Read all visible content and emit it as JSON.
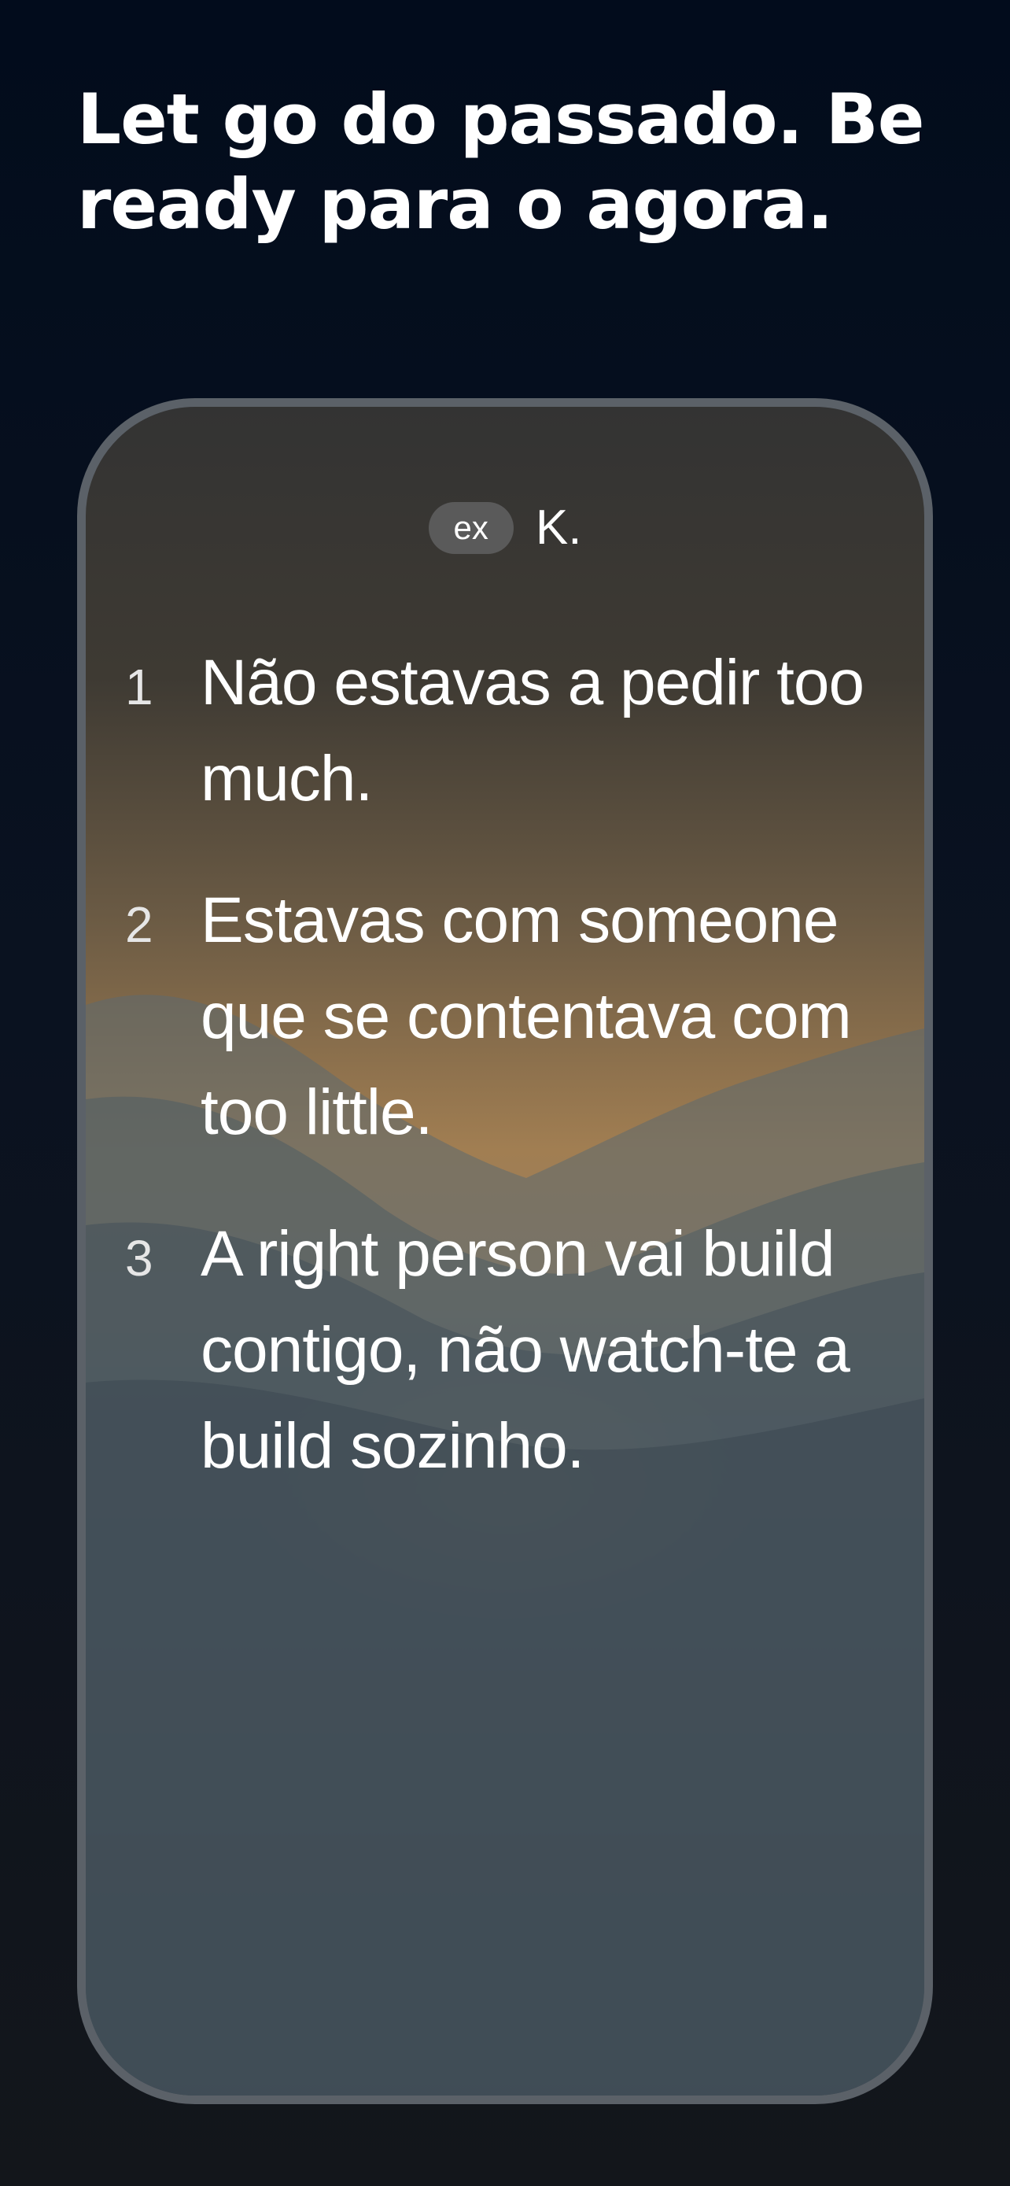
{
  "headline": "Let go do passado. Be ready para o agora.",
  "card": {
    "badge": "ex",
    "name": "K.",
    "items": [
      {
        "number": "1",
        "text": "Não estavas a pedir too much."
      },
      {
        "number": "2",
        "text": "Estavas com someone que se contentava com too little."
      },
      {
        "number": "3",
        "text": "A right person vai build contigo, não watch-te a build sozinho."
      }
    ]
  },
  "colors": {
    "background": "#020c1c",
    "frame": "#5b6168",
    "badge": "#5a5a5a",
    "sun_glow": "#fcbe6e"
  }
}
